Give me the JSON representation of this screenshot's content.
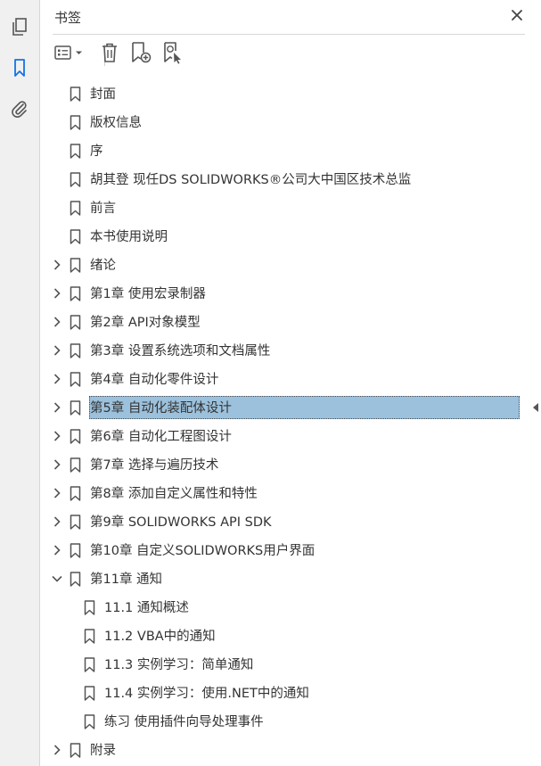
{
  "rail": {
    "buttons": [
      {
        "name": "page-thumbnails-icon"
      },
      {
        "name": "bookmarks-icon"
      },
      {
        "name": "attachments-icon"
      }
    ]
  },
  "panel": {
    "title": "书签",
    "close_icon": "close-icon"
  },
  "toolbar": {
    "buttons": [
      "options-menu-icon",
      "delete-bookmark-icon",
      "new-bookmark-icon",
      "find-bookmark-icon"
    ]
  },
  "bookmarks": [
    {
      "label": "封面",
      "level": 0,
      "expander": "none"
    },
    {
      "label": "版权信息",
      "level": 0,
      "expander": "none"
    },
    {
      "label": "序",
      "level": 0,
      "expander": "none"
    },
    {
      "label": "胡其登 现任DS SOLIDWORKS®公司大中国区技术总监",
      "level": 0,
      "expander": "none"
    },
    {
      "label": "前言",
      "level": 0,
      "expander": "none"
    },
    {
      "label": "本书使用说明",
      "level": 0,
      "expander": "none"
    },
    {
      "label": "绪论",
      "level": 0,
      "expander": "collapsed"
    },
    {
      "label": "第1章 使用宏录制器",
      "level": 0,
      "expander": "collapsed"
    },
    {
      "label": "第2章 API对象模型",
      "level": 0,
      "expander": "collapsed"
    },
    {
      "label": "第3章 设置系统选项和文档属性",
      "level": 0,
      "expander": "collapsed"
    },
    {
      "label": "第4章 自动化零件设计",
      "level": 0,
      "expander": "collapsed"
    },
    {
      "label": "第5章 自动化装配体设计",
      "level": 0,
      "expander": "collapsed",
      "selected": true
    },
    {
      "label": "第6章 自动化工程图设计",
      "level": 0,
      "expander": "collapsed"
    },
    {
      "label": "第7章 选择与遍历技术",
      "level": 0,
      "expander": "collapsed"
    },
    {
      "label": "第8章 添加自定义属性和特性",
      "level": 0,
      "expander": "collapsed"
    },
    {
      "label": "第9章 SOLIDWORKS API SDK",
      "level": 0,
      "expander": "collapsed"
    },
    {
      "label": "第10章 自定义SOLIDWORKS用户界面",
      "level": 0,
      "expander": "collapsed"
    },
    {
      "label": "第11章 通知",
      "level": 0,
      "expander": "expanded"
    },
    {
      "label": "11.1 通知概述",
      "level": 1,
      "expander": "none"
    },
    {
      "label": "11.2 VBA中的通知",
      "level": 1,
      "expander": "none"
    },
    {
      "label": "11.3 实例学习：简单通知",
      "level": 1,
      "expander": "none"
    },
    {
      "label": "11.4 实例学习：使用.NET中的通知",
      "level": 1,
      "expander": "none"
    },
    {
      "label": "练习 使用插件向导处理事件",
      "level": 1,
      "expander": "none"
    },
    {
      "label": "附录",
      "level": 0,
      "expander": "collapsed"
    }
  ],
  "colors": {
    "accent": "#1473e6",
    "selection": "#9cc1dc",
    "icon": "#555555",
    "rail_bg": "#f0f0f0"
  }
}
